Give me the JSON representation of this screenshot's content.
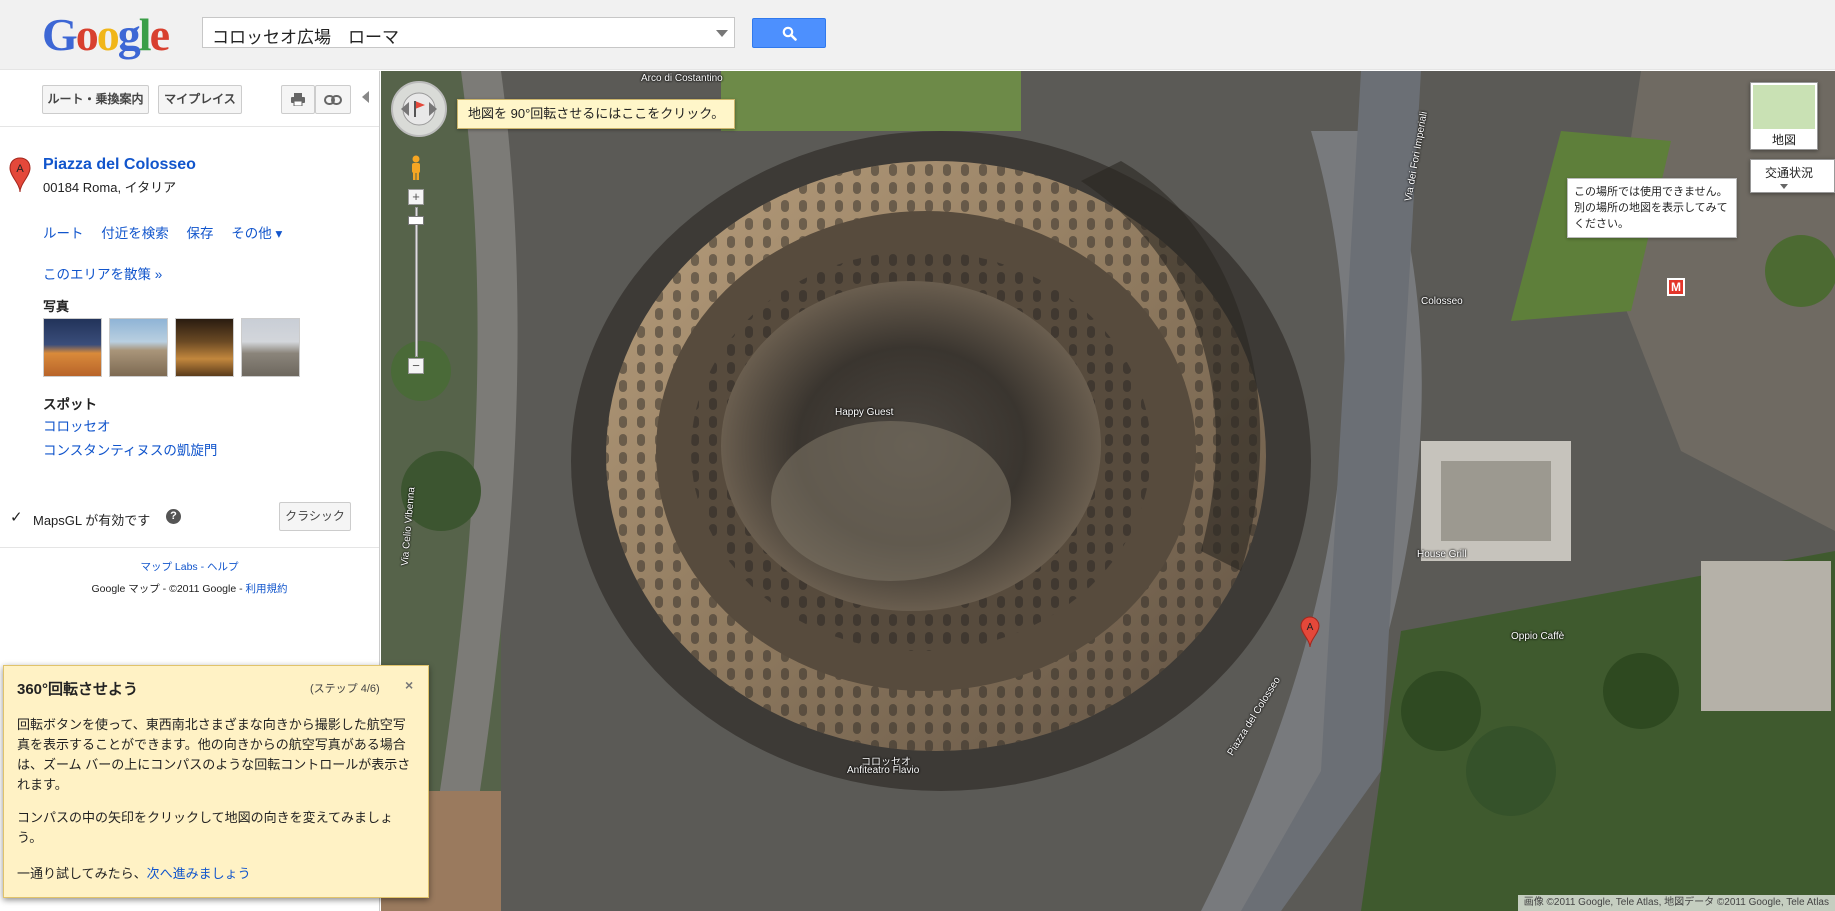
{
  "header": {
    "logo": {
      "letters": [
        "G",
        "o",
        "o",
        "g",
        "l",
        "e"
      ],
      "colors": [
        "#3d67d5",
        "#d8402f",
        "#f1b619",
        "#3d67d5",
        "#3a9e48",
        "#d8402f"
      ]
    },
    "search_value": "コロッセオ広場　ローマ",
    "search_button_icon": "search-icon"
  },
  "panel": {
    "toolbar": {
      "directions_label": "ルート・乗換案内",
      "my_places_label": "マイプレイス",
      "print_icon": "print-icon",
      "link_icon": "link-icon"
    },
    "place": {
      "marker": "A",
      "name": "Piazza del Colosseo",
      "address": "00184 Roma, イタリア",
      "actions": [
        "ルート",
        "付近を検索",
        "保存",
        "その他 ▾"
      ],
      "explore_link": "このエリアを散策 »"
    },
    "photos_title": "写真",
    "spots_title": "スポット",
    "spots": [
      "コロッセオ",
      "コンスタンティヌスの凱旋門"
    ],
    "mapsgl": {
      "check": "✓",
      "label": "MapsGL が有効です",
      "help": "?",
      "classic_button": "クラシック"
    },
    "footer": {
      "labs_link": "マップ Labs",
      "separator": " - ",
      "help_link": "ヘルプ",
      "copyright": "Google マップ - ©2011 Google - ",
      "terms_link": "利用規約"
    }
  },
  "map": {
    "rotate_tooltip": "地図を 90°回転させるにはここをクリック。",
    "zoom_in": "+",
    "zoom_out": "−",
    "map_type_label": "地図",
    "traffic_label": "交通状況",
    "unavailable_text": "この場所では使用できません。別の場所の地図を表示してみてください。",
    "pin_label": "A",
    "labels": {
      "arco": "Arco di Costantino",
      "happy_guest": "Happy Guest",
      "colosseo_jp": "コロッセオ",
      "anfiteatro": "Anfiteatro Flavio",
      "via_celio": "Via Celio Vibenna",
      "piazza": "Piazza del Colosseo",
      "house_grill": "House Grill",
      "oppio": "Oppio Caffè",
      "metro": "Colosseo",
      "via_fori": "Via dei Fori Imperiali"
    },
    "copyright": "画像 ©2011 Google, Tele Atlas, 地図データ ©2011 Google, Tele Atlas"
  },
  "tour": {
    "title": "360°回転させよう",
    "step": "(ステップ 4/6)",
    "close": "×",
    "body1": "回転ボタンを使って、東西南北さまざまな向きから撮影した航空写真を表示することができます。他の向きからの航空写真がある場合は、ズーム バーの上にコンパスのような回転コントロールが表示されます。",
    "body2": "コンパスの中の矢印をクリックして地図の向きを変えてみましょう。",
    "next_prefix": "一通り試してみたら、",
    "next_link": "次へ進みましょう"
  }
}
